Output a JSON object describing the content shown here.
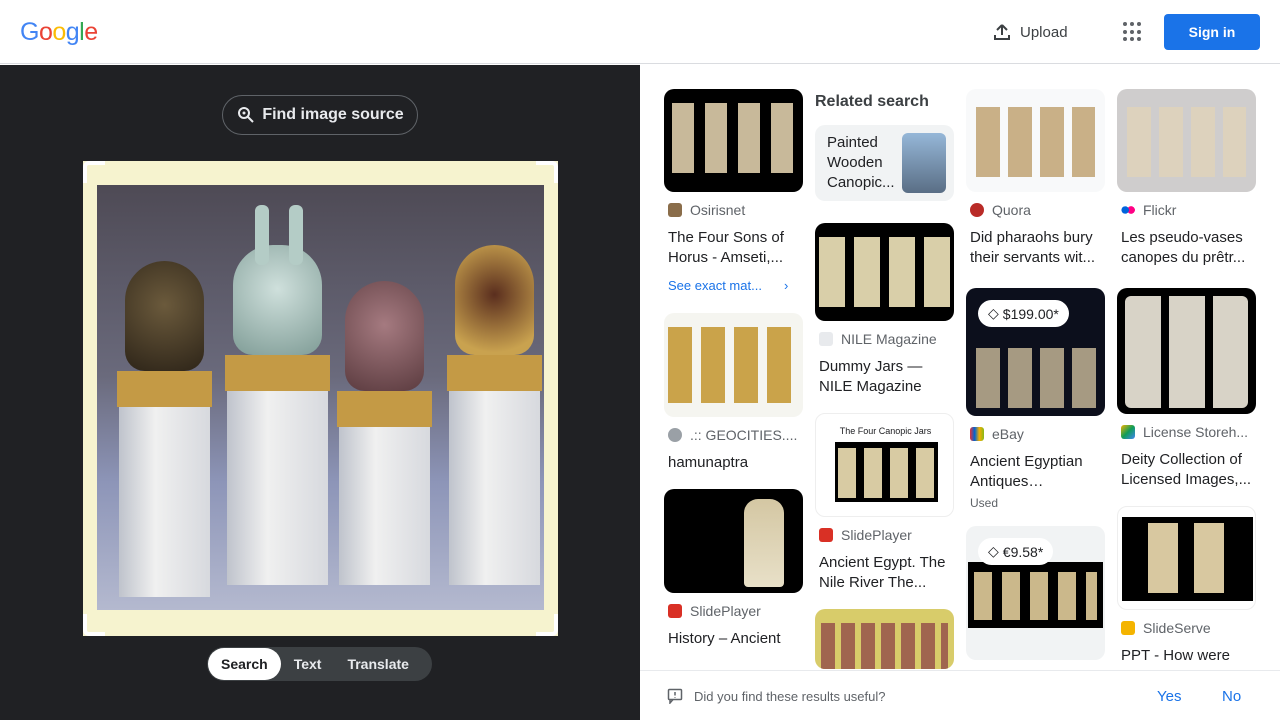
{
  "header": {
    "logo_letters": [
      {
        "ch": "G",
        "color": "#4285f4"
      },
      {
        "ch": "o",
        "color": "#ea4335"
      },
      {
        "ch": "o",
        "color": "#fbbc05"
      },
      {
        "ch": "g",
        "color": "#4285f4"
      },
      {
        "ch": "l",
        "color": "#34a853"
      },
      {
        "ch": "e",
        "color": "#ea4335"
      }
    ],
    "upload_label": "Upload",
    "upload_icon": "upload-icon",
    "apps_icon": "apps-grid-icon",
    "signin_label": "Sign in"
  },
  "left_panel": {
    "find_source_label": "Find image source",
    "find_source_icon": "lens-search-icon",
    "modes": [
      "Search",
      "Text",
      "Translate"
    ],
    "active_mode": "Search"
  },
  "results": {
    "related_heading": "Related search",
    "related_item": "Painted Wooden Canopic...",
    "columns": [
      [
        {
          "source": "Osirisnet",
          "title": "The Four Sons of Horus - Amseti,...",
          "exact_match": "See exact mat...",
          "thumb": "canopic-jars-black"
        },
        {
          "source": ".:: GEOCITIES....",
          "title": "hamunaptra",
          "thumb": "canopic-jars-white"
        },
        {
          "source": "SlidePlayer",
          "title": "History – Ancient",
          "thumb": "anubis-jar-slide"
        }
      ],
      [
        {
          "source": "NILE Magazine",
          "title": "Dummy Jars — NILE Magazine",
          "thumb": "dummy-jars"
        },
        {
          "source": "SlidePlayer",
          "title": "Ancient Egypt. The Nile River The...",
          "thumb": "four-canopic-jars",
          "caption": "The Four Canopic Jars"
        },
        {
          "source": "",
          "title": "",
          "thumb": "jars-on-yellow"
        }
      ],
      [
        {
          "source": "Quora",
          "title": "Did pharaohs bury their servants wit...",
          "thumb": "jars-grey"
        },
        {
          "source": "eBay",
          "title": "Ancient Egyptian Antiques Egyptian...",
          "price": "$199.00*",
          "used": "Used",
          "thumb": "jars-dark"
        },
        {
          "source": "",
          "title": "",
          "price": "€9.58*",
          "thumb": "jars-euro"
        }
      ],
      [
        {
          "source": "Flickr",
          "title": "Les pseudo-vases canopes du prêtr...",
          "thumb": "pseudo-vases"
        },
        {
          "source": "License Storeh...",
          "title": "Deity Collection of Licensed Images,...",
          "thumb": "deity-collection"
        },
        {
          "source": "SlideServe",
          "title": "PPT - How were",
          "thumb": "ppt-jars"
        }
      ]
    ]
  },
  "feedback": {
    "question": "Did you find these results useful?",
    "yes": "Yes",
    "no": "No"
  },
  "colors": {
    "primary": "#1a73e8",
    "dark_panel": "#202124"
  }
}
